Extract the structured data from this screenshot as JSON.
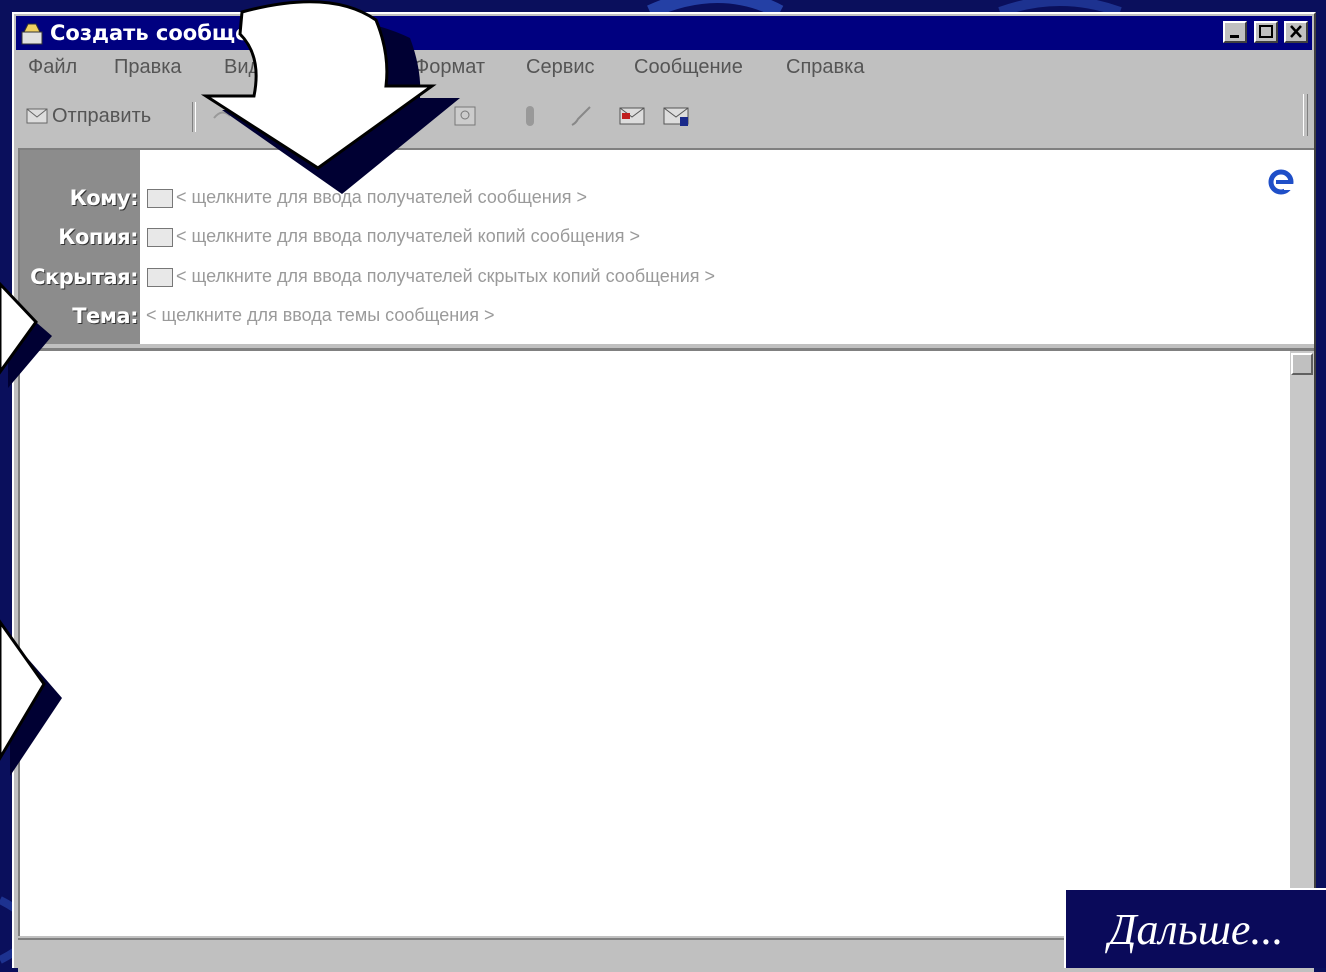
{
  "window": {
    "title": "Создать сообще"
  },
  "menu": [
    {
      "label": "Файл"
    },
    {
      "label": "Правка"
    },
    {
      "label": "Вид"
    },
    {
      "label": "Формат"
    },
    {
      "label": "Сервис"
    },
    {
      "label": "Сообщение"
    },
    {
      "label": "Справка"
    }
  ],
  "toolbar": {
    "send_label": "Отправить"
  },
  "header": {
    "to": {
      "label": "Кому:",
      "placeholder": "< щелкните для ввода получателей сообщения >"
    },
    "cc": {
      "label": "Копия:",
      "placeholder": "< щелкните для ввода получателей копий сообщения >"
    },
    "bcc": {
      "label": "Скрытая:",
      "placeholder": "< щелкните для ввода получателей скрытых копий сообщения >"
    },
    "subject": {
      "label": "Тема:",
      "placeholder": "< щелкните для ввода темы сообщения >"
    }
  },
  "next_button": {
    "label": "Дальше..."
  },
  "colors": {
    "slide_background": "#0a0f5c",
    "titlebar": "#000080",
    "window": "#c0c0c0"
  }
}
